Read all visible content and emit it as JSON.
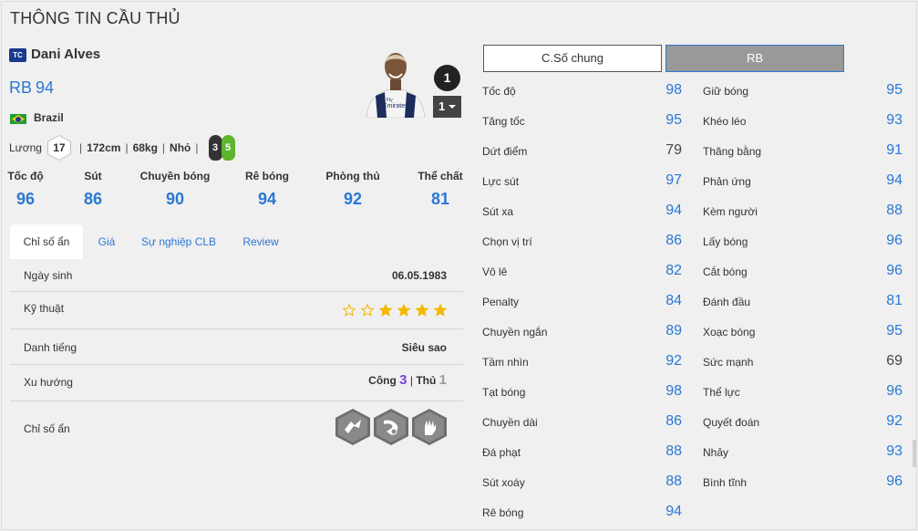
{
  "page_title": "THÔNG TIN CẦU THỦ",
  "player": {
    "club_badge": "TC",
    "name": "Dani Alves",
    "position": "RB",
    "ovr": "94",
    "nation": "Brazil",
    "salary_label": "Lương",
    "salary": "17",
    "height": "172cm",
    "weight": "68kg",
    "body_type": "Nhỏ",
    "weak_foot_left": "3",
    "weak_foot_right": "5",
    "season_badge": "1",
    "level": "1"
  },
  "summary": [
    {
      "label": "Tốc độ",
      "value": "96"
    },
    {
      "label": "Sút",
      "value": "86"
    },
    {
      "label": "Chuyền bóng",
      "value": "90"
    },
    {
      "label": "Rê bóng",
      "value": "94"
    },
    {
      "label": "Phòng thủ",
      "value": "92"
    },
    {
      "label": "Thể chất",
      "value": "81"
    }
  ],
  "tabs": [
    "Chỉ số ẩn",
    "Giá",
    "Sự nghiệp CLB",
    "Review"
  ],
  "info": {
    "birthday_label": "Ngày sinh",
    "birthday": "06.05.1983",
    "skill_label": "Kỹ thuật",
    "skill_stars": 4,
    "skill_stars_max": 6,
    "reputation_label": "Danh tiếng",
    "reputation": "Siêu sao",
    "trend_label": "Xu hướng",
    "trend_attack_label": "Công",
    "trend_attack": "3",
    "trend_divider": "|",
    "trend_defense_label": "Thủ",
    "trend_defense": "1",
    "hidden_label": "Chỉ số ẩn",
    "hidden_traits": [
      "pass-trait-icon",
      "outside-foot-trait-icon",
      "hand-trait-icon"
    ]
  },
  "position_tabs": {
    "general": "C.Số chung",
    "rb": "RB"
  },
  "stats_left": [
    {
      "name": "Tốc độ",
      "value": "98",
      "color": "blue"
    },
    {
      "name": "Tăng tốc",
      "value": "95",
      "color": "blue"
    },
    {
      "name": "Dứt điểm",
      "value": "79",
      "color": "gray"
    },
    {
      "name": "Lực sút",
      "value": "97",
      "color": "blue"
    },
    {
      "name": "Sút xa",
      "value": "94",
      "color": "blue"
    },
    {
      "name": "Chọn vị trí",
      "value": "86",
      "color": "blue"
    },
    {
      "name": "Vô lê",
      "value": "82",
      "color": "blue"
    },
    {
      "name": "Penalty",
      "value": "84",
      "color": "blue"
    },
    {
      "name": "Chuyền ngắn",
      "value": "89",
      "color": "blue"
    },
    {
      "name": "Tầm nhìn",
      "value": "92",
      "color": "blue"
    },
    {
      "name": "Tạt bóng",
      "value": "98",
      "color": "blue"
    },
    {
      "name": "Chuyền dài",
      "value": "86",
      "color": "blue"
    },
    {
      "name": "Đá phạt",
      "value": "88",
      "color": "blue"
    },
    {
      "name": "Sút xoáy",
      "value": "88",
      "color": "blue"
    },
    {
      "name": "Rê bóng",
      "value": "94",
      "color": "blue"
    }
  ],
  "stats_right": [
    {
      "name": "Giữ bóng",
      "value": "95",
      "color": "blue"
    },
    {
      "name": "Khéo léo",
      "value": "93",
      "color": "blue"
    },
    {
      "name": "Thăng bằng",
      "value": "91",
      "color": "blue"
    },
    {
      "name": "Phản ứng",
      "value": "94",
      "color": "blue"
    },
    {
      "name": "Kèm người",
      "value": "88",
      "color": "blue"
    },
    {
      "name": "Lấy bóng",
      "value": "96",
      "color": "blue"
    },
    {
      "name": "Cắt bóng",
      "value": "96",
      "color": "blue"
    },
    {
      "name": "Đánh đầu",
      "value": "81",
      "color": "blue"
    },
    {
      "name": "Xoạc bóng",
      "value": "95",
      "color": "blue"
    },
    {
      "name": "Sức mạnh",
      "value": "69",
      "color": "gray"
    },
    {
      "name": "Thể lực",
      "value": "96",
      "color": "blue"
    },
    {
      "name": "Quyết đoán",
      "value": "92",
      "color": "blue"
    },
    {
      "name": "Nhảy",
      "value": "93",
      "color": "blue"
    },
    {
      "name": "Bình tĩnh",
      "value": "96",
      "color": "blue"
    }
  ],
  "colors": {
    "accent": "#2a78d4",
    "attack": "#7b3fe4",
    "star": "#f5b800"
  }
}
